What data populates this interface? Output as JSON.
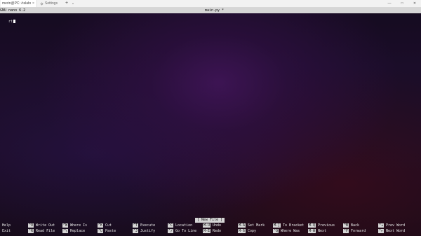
{
  "tabs": [
    {
      "label": "merin@PC: /ralabo",
      "active": true
    },
    {
      "label": "Settings",
      "active": false
    }
  ],
  "titlebar": {
    "new_tab_symbol": "+",
    "dropdown_symbol": "⌄",
    "close_tab_symbol": "×",
    "minimize_symbol": "—",
    "maximize_symbol": "□",
    "close_symbol": "✕"
  },
  "nano": {
    "version": "GNU nano 6.2",
    "filename": "main.py",
    "modified_marker": "*",
    "editor_line": "rt"
  },
  "status": {
    "message": "[ New File ]"
  },
  "shortcuts": {
    "row1": [
      {
        "key": "",
        "label": "Help"
      },
      {
        "key": "^O",
        "label": "Write Out"
      },
      {
        "key": "^W",
        "label": "Where Is"
      },
      {
        "key": "^K",
        "label": "Cut"
      },
      {
        "key": "^T",
        "label": "Execute"
      },
      {
        "key": "^C",
        "label": "Location"
      },
      {
        "key": "M-U",
        "label": "Undo"
      },
      {
        "key": "M-A",
        "label": "Set Mark"
      },
      {
        "key": "M-]",
        "label": "To Bracket"
      },
      {
        "key": "M-Q",
        "label": "Previous"
      },
      {
        "key": "^B",
        "label": "Back"
      },
      {
        "key": "^◂",
        "label": "Prev Word"
      }
    ],
    "row2": [
      {
        "key": "",
        "label": "Exit"
      },
      {
        "key": "^R",
        "label": "Read File"
      },
      {
        "key": "^\\",
        "label": "Replace"
      },
      {
        "key": "^U",
        "label": "Paste"
      },
      {
        "key": "^J",
        "label": "Justify"
      },
      {
        "key": "^/",
        "label": "Go To Line"
      },
      {
        "key": "M-E",
        "label": "Redo"
      },
      {
        "key": "M-6",
        "label": "Copy"
      },
      {
        "key": "^Q",
        "label": "Where Was"
      },
      {
        "key": "M-W",
        "label": "Next"
      },
      {
        "key": "^F",
        "label": "Forward"
      },
      {
        "key": "^▸",
        "label": "Next Word"
      }
    ]
  },
  "colors": {
    "titlebar": "#f2f2f2",
    "nano_bar": "#d6d6d6",
    "terminal_text": "#e5e5e5",
    "background_purple": "#1b0d29",
    "background_red": "#520c18"
  },
  "icons": {
    "settings_tab": "gear-icon",
    "new_tab": "plus-icon",
    "dropdown": "chevron-down-icon",
    "tab_close": "close-icon",
    "minimize": "minimize-icon",
    "maximize": "maximize-icon",
    "window_close": "close-icon"
  }
}
